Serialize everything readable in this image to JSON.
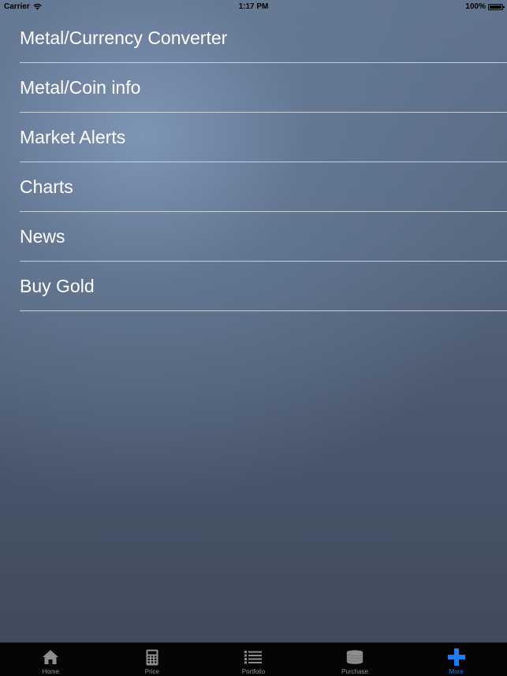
{
  "status_bar": {
    "carrier": "Carrier",
    "time": "1:17 PM",
    "battery": "100%"
  },
  "menu": {
    "items": [
      {
        "label": "Metal/Currency Converter"
      },
      {
        "label": "Metal/Coin info"
      },
      {
        "label": "Market Alerts"
      },
      {
        "label": "Charts"
      },
      {
        "label": "News"
      },
      {
        "label": "Buy Gold"
      }
    ]
  },
  "tab_bar": {
    "tabs": [
      {
        "label": "Home",
        "icon": "home-icon"
      },
      {
        "label": "Price",
        "icon": "calculator-icon"
      },
      {
        "label": "Portfolio",
        "icon": "list-icon"
      },
      {
        "label": "Purchase",
        "icon": "coin-stack-icon"
      },
      {
        "label": "More",
        "icon": "plus-icon",
        "active": true
      }
    ],
    "active_color": "#1e7cf5",
    "inactive_color": "#8e8e8e"
  }
}
